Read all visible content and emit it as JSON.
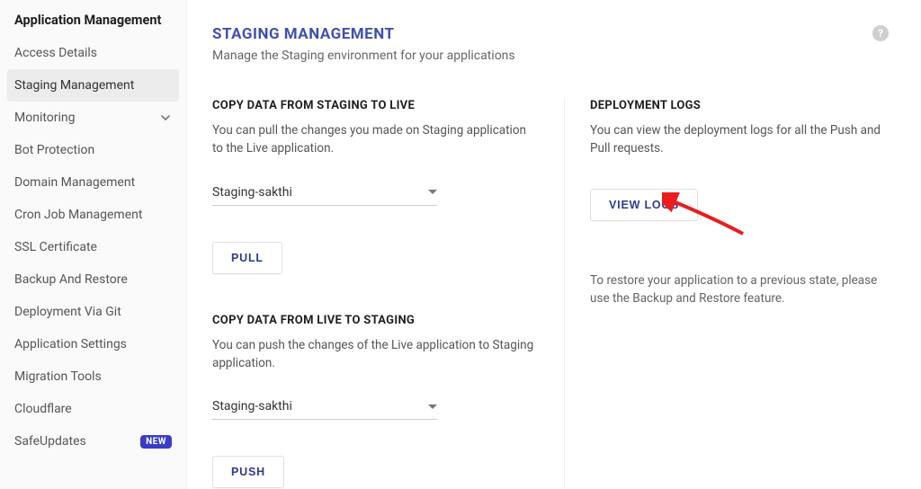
{
  "sidebar": {
    "title": "Application Management",
    "items": [
      {
        "label": "Access Details"
      },
      {
        "label": "Staging Management"
      },
      {
        "label": "Monitoring"
      },
      {
        "label": "Bot Protection"
      },
      {
        "label": "Domain Management"
      },
      {
        "label": "Cron Job Management"
      },
      {
        "label": "SSL Certificate"
      },
      {
        "label": "Backup And Restore"
      },
      {
        "label": "Deployment Via Git"
      },
      {
        "label": "Application Settings"
      },
      {
        "label": "Migration Tools"
      },
      {
        "label": "Cloudflare"
      },
      {
        "label": "SafeUpdates"
      }
    ],
    "new_badge": "NEW"
  },
  "header": {
    "title": "STAGING MANAGEMENT",
    "subtitle": "Manage the Staging environment for your applications",
    "help": "?"
  },
  "copy_to_live": {
    "title": "COPY DATA FROM STAGING TO LIVE",
    "desc": "You can pull the changes you made on Staging application to the Live application.",
    "selected": "Staging-sakthi",
    "button": "PULL"
  },
  "copy_to_staging": {
    "title": "COPY DATA FROM LIVE TO STAGING",
    "desc": "You can push the changes of the Live application to Staging application.",
    "selected": "Staging-sakthi",
    "button": "PUSH"
  },
  "deployment_logs": {
    "title": "DEPLOYMENT LOGS",
    "desc": "You can view the deployment logs for all the Push and Pull requests.",
    "button": "VIEW LOGS",
    "restore_note": "To restore your application to a previous state, please use the Backup and Restore feature."
  }
}
